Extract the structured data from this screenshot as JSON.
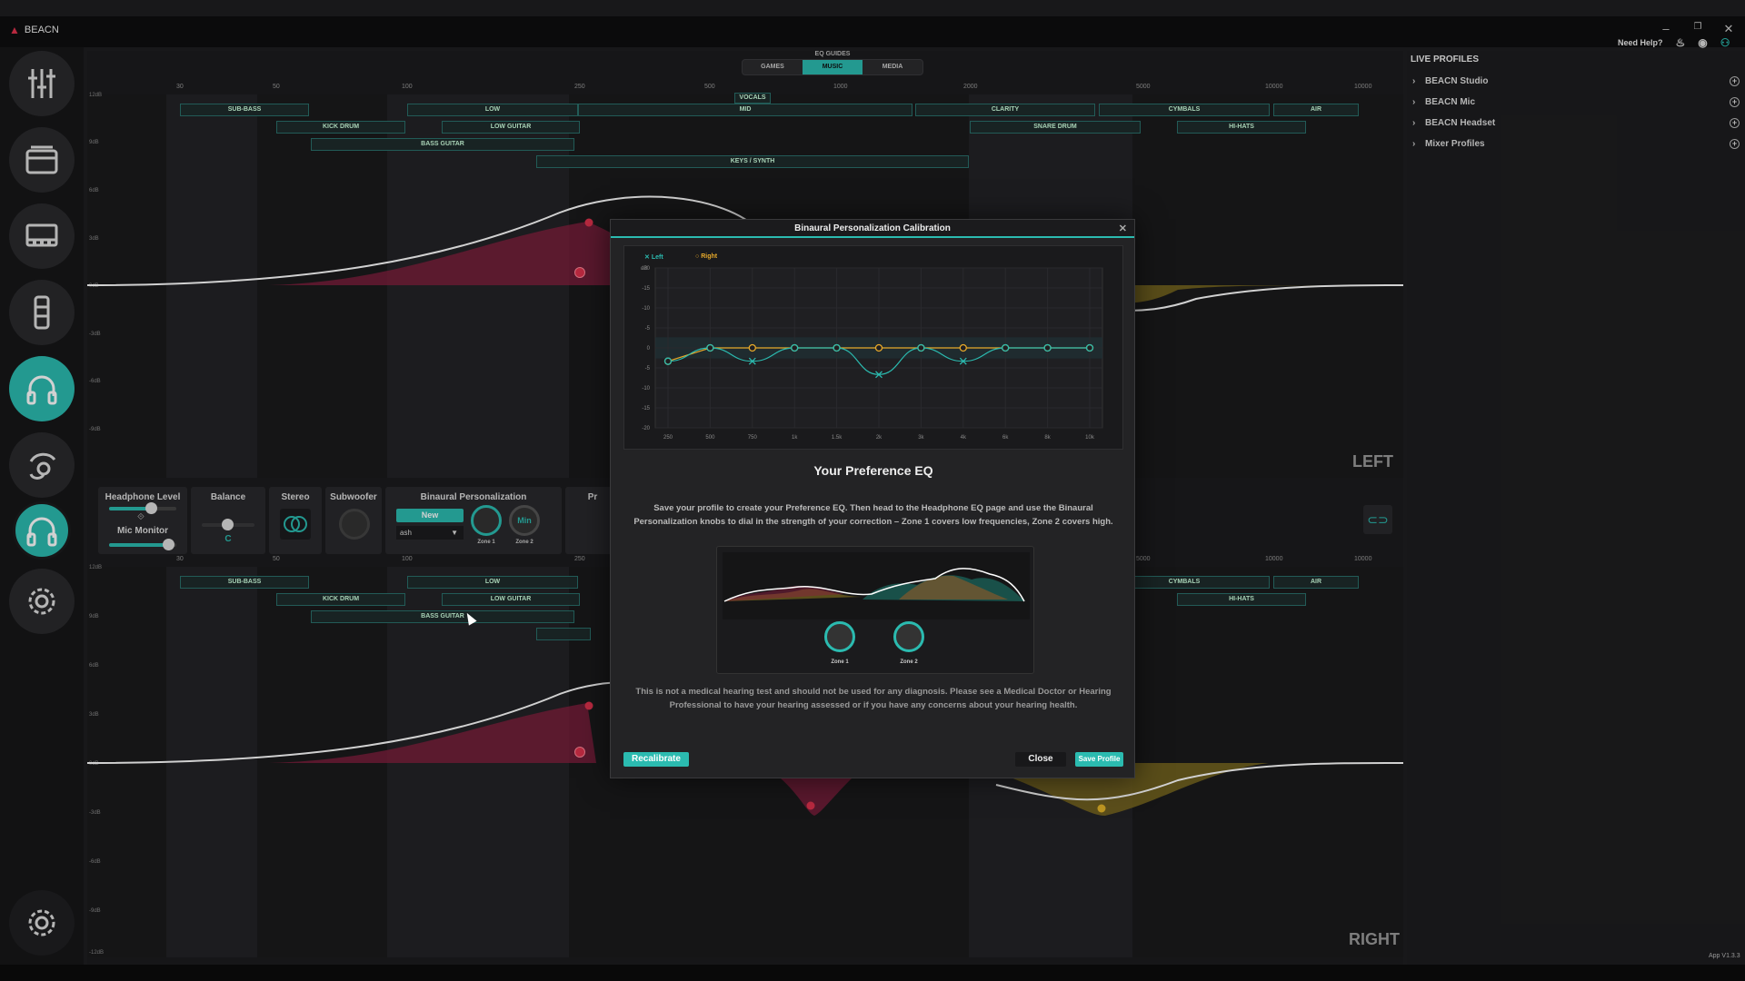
{
  "app": {
    "title": "BEACN",
    "version": "App V1.3.3"
  },
  "window_controls": {
    "minimize": "–",
    "maximize": "❐",
    "close": "✕"
  },
  "header": {
    "help_label": "Need Help?"
  },
  "eq_guides": {
    "label": "EQ GUIDES",
    "tabs": [
      {
        "label": "GAMES"
      },
      {
        "label": "MUSIC"
      },
      {
        "label": "MEDIA"
      }
    ],
    "selected": "MUSIC"
  },
  "freq_ticks": [
    "30",
    "50",
    "100",
    "250",
    "500",
    "1000",
    "2000",
    "5000",
    "10000",
    "10000"
  ],
  "db_ticks_top": [
    "12dB",
    "9dB",
    "6dB",
    "3dB",
    "0dB",
    "-3dB",
    "-6dB",
    "-9dB"
  ],
  "db_ticks_bottom": [
    "12dB",
    "9dB",
    "6dB",
    "3dB",
    "0dB",
    "-3dB",
    "-6dB",
    "-9dB",
    "-12dB"
  ],
  "chips_top": [
    "SUB-BASS",
    "LOW",
    "MID",
    "CLARITY",
    "CYMBALS",
    "AIR",
    "VOCALS",
    "KICK DRUM",
    "LOW GUITAR",
    "SNARE DRUM",
    "HI-HATS",
    "BASS GUITAR",
    "KEYS / SYNTH"
  ],
  "chips_bottom": [
    "SUB-BASS",
    "LOW",
    "CYMBALS",
    "AIR",
    "KICK DRUM",
    "LOW GUITAR",
    "HI-HATS",
    "BASS GUITAR"
  ],
  "channel_labels": {
    "left": "LEFT",
    "right": "RIGHT"
  },
  "controls": {
    "headphone_level": "Headphone Level",
    "mic_monitor": "Mic Monitor",
    "headphone_level_value": 0.62,
    "mic_monitor_value": 0.88,
    "balance": "Balance",
    "balance_value": "C",
    "stereo": "Stereo",
    "subwoofer": "Subwoofer",
    "binaural": "Binaural Personalization",
    "new_button": "New",
    "profile_select": "ash",
    "zone1": "Zone 1",
    "zone2": "Zone 2",
    "zone2_value": "Min",
    "partial_label": "Pr"
  },
  "live_profiles": {
    "header": "LIVE PROFILES",
    "items": [
      {
        "label": "BEACN Studio"
      },
      {
        "label": "BEACN Mic"
      },
      {
        "label": "BEACN Headset"
      },
      {
        "label": "Mixer Profiles"
      }
    ]
  },
  "modal": {
    "title": "Binaural Personalization Calibration",
    "legend_left": "Left",
    "legend_right": "Right",
    "y_unit": "dB",
    "preference_title": "Your Preference EQ",
    "description": "Save your profile to create your Preference EQ. Then head to the Headphone EQ page and use the Binaural Personalization knobs to dial in the strength of your correction – Zone 1 covers low frequencies, Zone 2 covers high.",
    "zone1_label": "Zone 1",
    "zone2_label": "Zone 2",
    "disclaimer": "This is not a medical hearing test and should not be used for any diagnosis. Please see a Medical Doctor or Hearing Professional to have your hearing assessed or if you have any concerns about your hearing health.",
    "recalibrate": "Recalibrate",
    "close": "Close",
    "save_profile": "Save Profile"
  },
  "colors": {
    "accent": "#2bbbb0",
    "left_curve": "#2bbbb0",
    "right_curve": "#e6a92a",
    "eq_red": "#e0324d",
    "eq_gold": "#c9a227"
  },
  "chart_data": {
    "type": "line",
    "categories": [
      "250",
      "500",
      "750",
      "1k",
      "1.5k",
      "2k",
      "3k",
      "4k",
      "6k",
      "8k",
      "10k"
    ],
    "y_ticks": [
      "-20",
      "-15",
      "-10",
      "-5",
      "0",
      "-5",
      "-10",
      "-15",
      "-20"
    ],
    "ylim": [
      -30,
      30
    ],
    "series": [
      {
        "name": "Left",
        "values": [
          -5,
          0,
          -5,
          0,
          0,
          -10,
          0,
          -5,
          0,
          0,
          0
        ]
      },
      {
        "name": "Right",
        "values": [
          -5,
          0,
          0,
          0,
          0,
          0,
          0,
          0,
          0,
          0,
          0
        ]
      }
    ]
  }
}
